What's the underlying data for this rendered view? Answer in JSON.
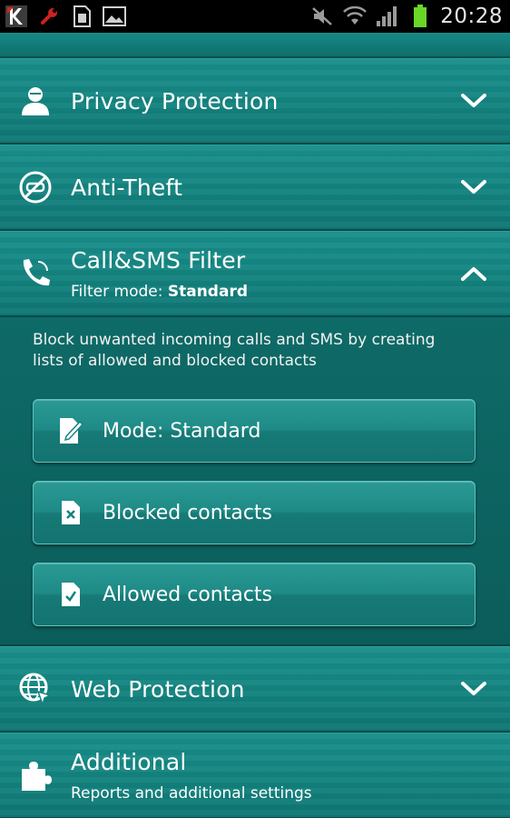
{
  "status_bar": {
    "time": "20:28",
    "icons": [
      "kaspersky-icon",
      "wrench-icon",
      "sim-card-icon",
      "gallery-icon",
      "mute-icon",
      "wifi-icon",
      "signal-icon",
      "battery-icon"
    ]
  },
  "sections": {
    "privacy": {
      "title": "Privacy Protection",
      "icon": "person-icon",
      "expanded": false
    },
    "antitheft": {
      "title": "Anti-Theft",
      "icon": "phone-crossed-icon",
      "expanded": false
    },
    "callsms": {
      "title": "Call&SMS Filter",
      "sub_prefix": "Filter mode: ",
      "sub_value": "Standard",
      "icon": "phone-handset-icon",
      "expanded": true,
      "description": "Block unwanted incoming calls and SMS by creating lists of allowed and blocked contacts",
      "buttons": {
        "mode": "Mode: Standard",
        "blocked": "Blocked contacts",
        "allowed": "Allowed contacts"
      }
    },
    "web": {
      "title": "Web Protection",
      "icon": "globe-icon",
      "expanded": false
    },
    "additional": {
      "title": "Additional",
      "subtitle": "Reports and additional settings",
      "icon": "puzzle-icon"
    }
  },
  "colors": {
    "accent_teal": "#148480",
    "status_bar_bg": "#000000",
    "battery_green": "#6ad628"
  }
}
